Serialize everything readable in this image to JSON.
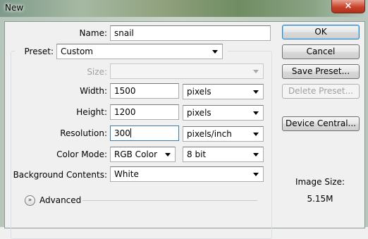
{
  "window": {
    "title": "New",
    "close_label": "×"
  },
  "form": {
    "name_label": "Name:",
    "name_value": "snail",
    "preset_label": "Preset:",
    "preset_value": "Custom",
    "size_label": "Size:",
    "size_value": "",
    "width_label": "Width:",
    "width_value": "1500",
    "width_unit": "pixels",
    "height_label": "Height:",
    "height_value": "1200",
    "height_unit": "pixels",
    "resolution_label": "Resolution:",
    "resolution_value": "300",
    "resolution_unit": "pixels/inch",
    "color_mode_label": "Color Mode:",
    "color_mode_value": "RGB Color",
    "bit_depth_value": "8 bit",
    "background_label": "Background Contents:",
    "background_value": "White",
    "advanced_label": "Advanced"
  },
  "buttons": {
    "ok": "OK",
    "cancel": "Cancel",
    "save_preset": "Save Preset...",
    "delete_preset": "Delete Preset...",
    "device_central": "Device Central..."
  },
  "info": {
    "image_size_label": "Image Size:",
    "image_size_value": "5.15M"
  },
  "icons": {
    "advanced_toggle": "chevron-down-icon",
    "dropdown": "dropdown-arrow-icon"
  }
}
